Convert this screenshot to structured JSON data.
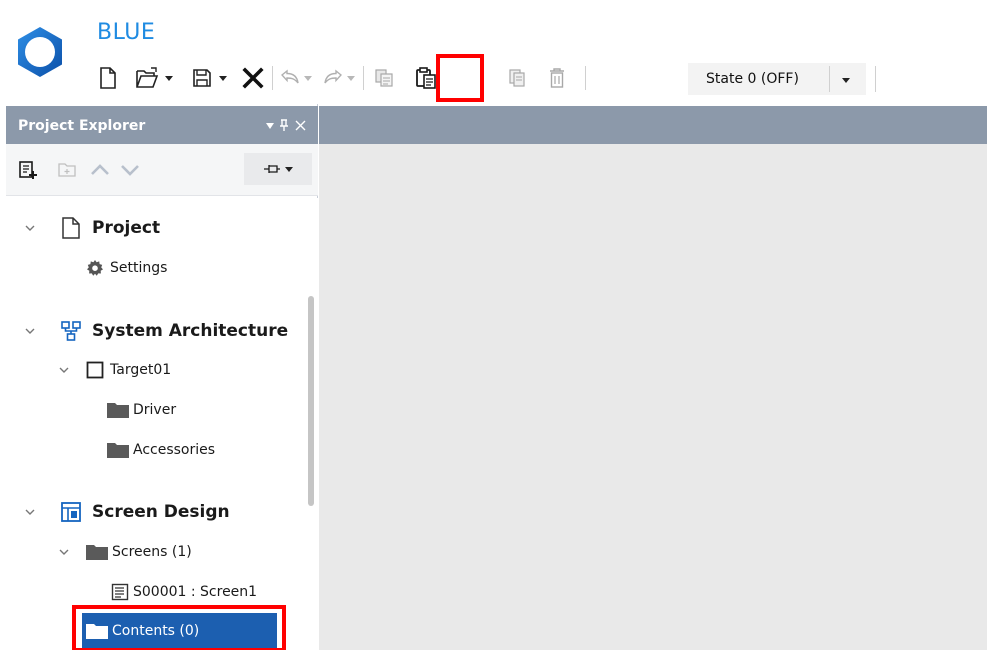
{
  "app": {
    "title": "BLUE"
  },
  "toolbar": {
    "items": [
      {
        "name": "new-file",
        "enabled": true
      },
      {
        "name": "open-folder",
        "enabled": true,
        "dropdown": true
      },
      {
        "name": "save",
        "enabled": true,
        "dropdown": true
      },
      {
        "name": "close",
        "enabled": true
      },
      {
        "name": "undo",
        "enabled": false,
        "dropdown": true
      },
      {
        "name": "redo",
        "enabled": false,
        "dropdown": true
      },
      {
        "name": "copy",
        "enabled": false
      },
      {
        "name": "paste",
        "enabled": true,
        "highlighted": true
      },
      {
        "name": "duplicate",
        "enabled": false
      },
      {
        "name": "delete",
        "enabled": false
      }
    ],
    "state_select": {
      "value": "State 0 (OFF)"
    }
  },
  "explorer": {
    "title": "Project Explorer",
    "tree": {
      "project": {
        "label": "Project",
        "settings": "Settings"
      },
      "system_architecture": {
        "label": "System Architecture",
        "target": "Target01",
        "driver": "Driver",
        "accessories": "Accessories"
      },
      "screen_design": {
        "label": "Screen Design",
        "screens": "Screens (1)",
        "screen1": "S00001 : Screen1",
        "contents": "Contents (0)"
      }
    },
    "selected": "Contents (0)"
  },
  "colors": {
    "accent": "#1f8be2",
    "panel_header": "#8c99aa",
    "selection": "#1c5fb0",
    "highlight": "#ff0000",
    "workspace": "#e9e9e9"
  }
}
